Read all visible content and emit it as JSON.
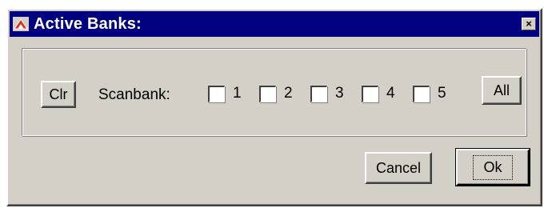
{
  "window": {
    "title": "Active Banks:",
    "close_glyph": "×",
    "title_bar_color": "#000080",
    "face_color": "#d4d0c8"
  },
  "controls": {
    "clear_label": "Clr",
    "scanbank_label": "Scanbank:",
    "all_label": "All",
    "banks": [
      {
        "label": "1",
        "checked": false
      },
      {
        "label": "2",
        "checked": false
      },
      {
        "label": "3",
        "checked": false
      },
      {
        "label": "4",
        "checked": false
      },
      {
        "label": "5",
        "checked": false
      }
    ]
  },
  "footer": {
    "cancel_label": "Cancel",
    "ok_label": "Ok"
  },
  "icons": {
    "app": "app-icon",
    "close": "close-icon"
  }
}
